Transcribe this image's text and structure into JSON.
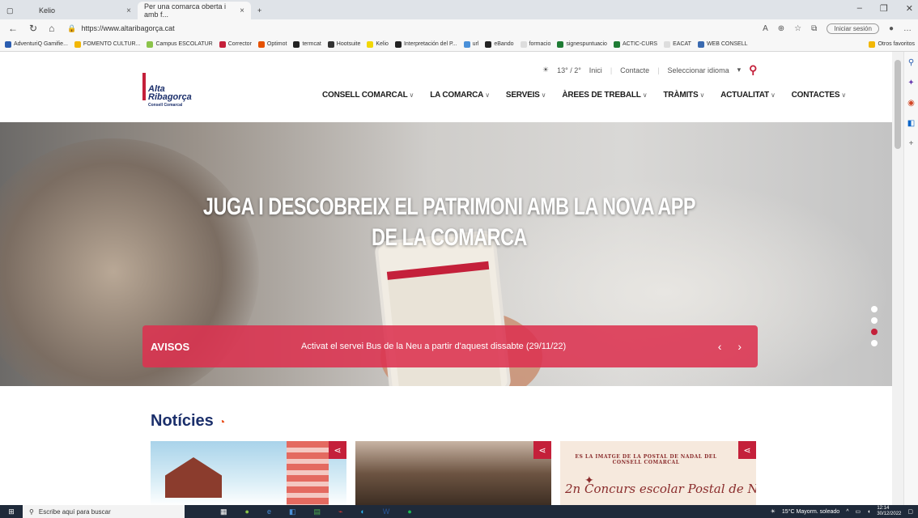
{
  "browser": {
    "tabs": [
      {
        "title": "Kelio",
        "active": false
      },
      {
        "title": "Per una comarca oberta i amb f...",
        "active": true
      }
    ],
    "new_tab": "+",
    "url": "https://www.altaribagorça.cat",
    "login_label": "Iniciar sesión",
    "bookmarks": [
      "AdventuriQ Gamifie...",
      "FOMENTO CULTUR...",
      "Campus ESCOLATUR",
      "Corrector",
      "Optimot",
      "termcat",
      "Hootsuite",
      "Kelio",
      "Interpretación del P...",
      "url",
      "eBando",
      "formacio",
      "signespuntuacio",
      "ACTIC-CURS",
      "EACAT",
      "WEB CONSELL"
    ],
    "bookmarks_more": "Otros favoritos"
  },
  "site": {
    "weather": "13° / 2°",
    "links": [
      "Inici",
      "Contacte"
    ],
    "language_select": "Seleccionar idioma",
    "logo": {
      "line1": "Alta",
      "line2": "Ribagorça",
      "line3": "Consell Comarcal"
    },
    "menu": [
      "CONSELL COMARCAL",
      "LA COMARCA",
      "SERVEIS",
      "ÀREES DE TREBALL",
      "TRÀMITS",
      "ACTUALITAT",
      "CONTACTES"
    ],
    "hero": {
      "title": "JUGA I DESCOBREIX EL PATRIMONI AMB LA NOVA APP DE LA COMARCA",
      "slides": 4,
      "active_slide": 3
    },
    "avisos": {
      "label": "AVISOS",
      "message": "Activat el servei Bus de la Neu a partir d'aquest dissabte (29/11/22)",
      "arrows": "‹ ›"
    },
    "news": {
      "title": "Notícies",
      "cards": [
        {
          "id": "card-1"
        },
        {
          "id": "card-2"
        },
        {
          "id": "card-3",
          "header": "ES LA IMATGE DE LA POSTAL DE NADAL DEL CONSELL COMARCAL",
          "script": "2n Concurs escolar Postal de N"
        }
      ]
    }
  },
  "taskbar": {
    "search_placeholder": "Escribe aquí para buscar",
    "weather": "15°C Mayorm. soleado",
    "time": "12:14",
    "date": "30/12/2022"
  }
}
